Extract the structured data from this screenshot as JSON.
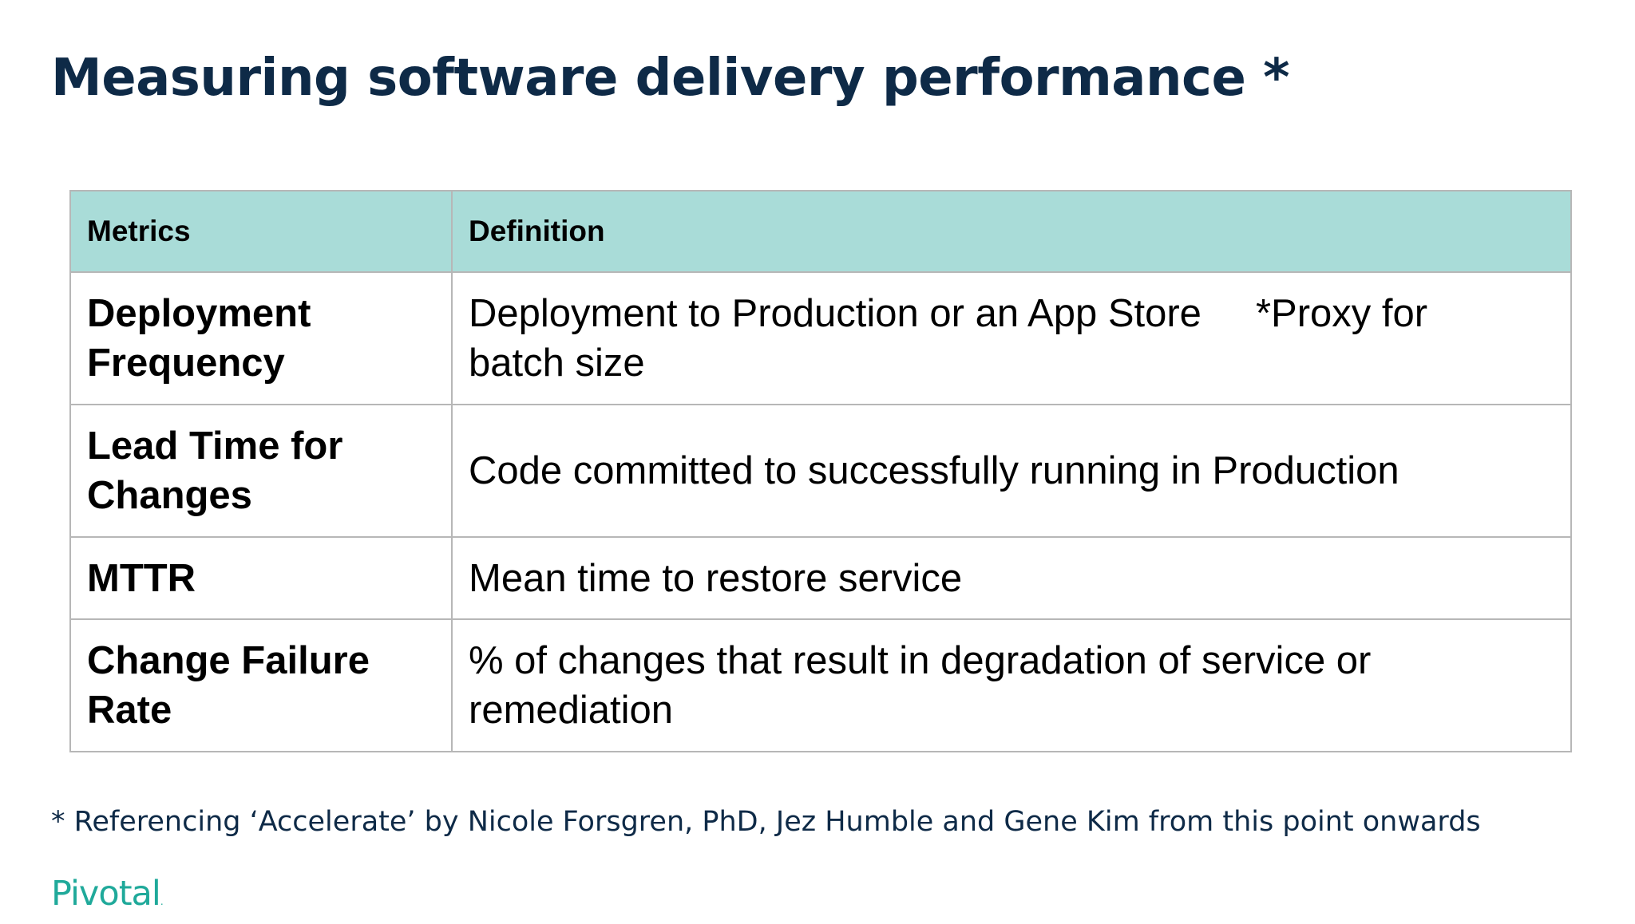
{
  "slide": {
    "title": "Measuring software delivery performance *",
    "footnote": "* Referencing ‘Accelerate’ by Nicole Forsgren, PhD, Jez Humble and Gene Kim from this point onwards",
    "brand": "Pivotal",
    "brand_dot": ".",
    "brand_color": "#1fa99a",
    "title_color": "#0e2a47",
    "header_bg_color": "#a9dcd8"
  },
  "table": {
    "headers": [
      "Metrics",
      "Definition"
    ],
    "rows": [
      {
        "metric": "Deployment Frequency",
        "definition": "Deployment to Production or an App Store",
        "note": "*Proxy for",
        "definition_cont": "batch size"
      },
      {
        "metric": "Lead Time for Changes",
        "definition": "Code committed to successfully running in Production"
      },
      {
        "metric": "MTTR",
        "definition": "Mean time to restore service"
      },
      {
        "metric": "Change Failure Rate",
        "definition": "% of changes that result in degradation of service or remediation"
      }
    ]
  }
}
